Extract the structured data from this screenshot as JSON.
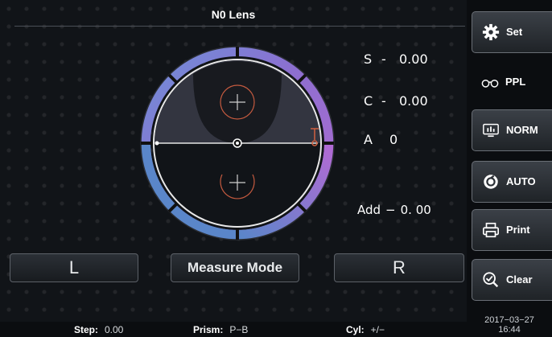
{
  "header": {
    "title": "N0 Lens"
  },
  "readouts": {
    "sphere": {
      "label": "S",
      "sep": "-",
      "value": "0.00"
    },
    "cylinder": {
      "label": "C",
      "sep": "-",
      "value": "0.00"
    },
    "axis": {
      "label": "A",
      "value": "0"
    },
    "add": {
      "label": "Add",
      "sep": "−",
      "value": "0. 00"
    }
  },
  "buttons": {
    "left": "L",
    "measure_mode": "Measure Mode",
    "right": "R"
  },
  "sidebar": {
    "set": "Set",
    "ppl": "PPL",
    "norm": "NORM",
    "auto": "AUTO",
    "print": "Print",
    "clear": "Clear"
  },
  "datetime": {
    "date": "2017−03−27",
    "time": "16:44"
  },
  "status": {
    "step": {
      "label": "Step:",
      "value": "0.00"
    },
    "prism": {
      "label": "Prism:",
      "value": "P−B"
    },
    "cyl": {
      "label": "Cyl:",
      "value": "+/−"
    }
  },
  "colors": {
    "ring_blue": "#5a86c9",
    "ring_purple": "#9b5fc4",
    "target_red": "#c45a3f"
  }
}
